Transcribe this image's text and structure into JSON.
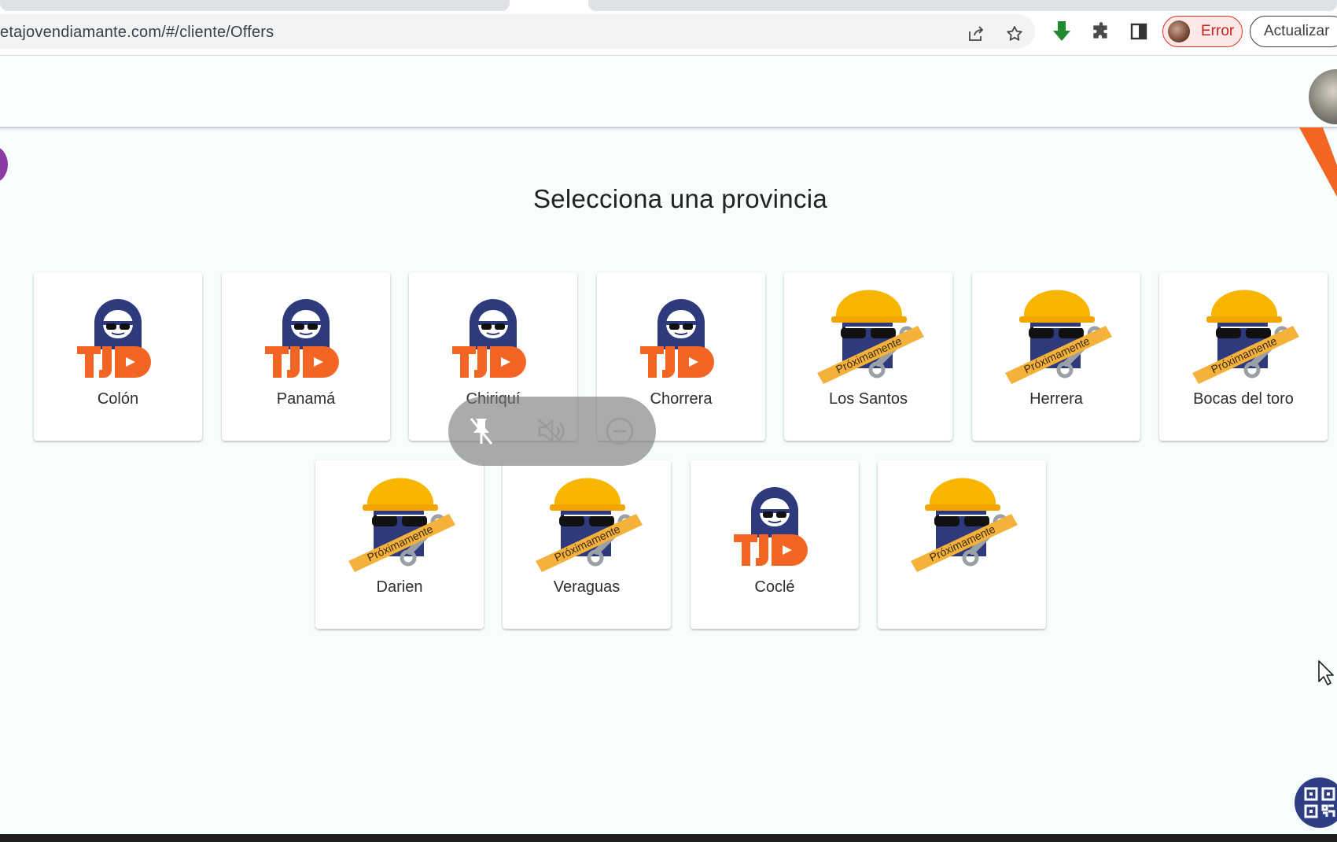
{
  "browser": {
    "url": "etajovendiamante.com/#/cliente/Offers",
    "profile_status": "Error",
    "update_label": "Actualizar"
  },
  "page": {
    "title": "Selecciona una provincia"
  },
  "provinces": [
    {
      "name": "Colón",
      "status": "available"
    },
    {
      "name": "Panamá",
      "status": "available"
    },
    {
      "name": "Chiriquí",
      "status": "available"
    },
    {
      "name": "Chorrera",
      "status": "available"
    },
    {
      "name": "Los Santos",
      "status": "coming-soon"
    },
    {
      "name": "Herrera",
      "status": "coming-soon"
    },
    {
      "name": "Bocas del toro",
      "status": "coming-soon"
    },
    {
      "name": "Darien",
      "status": "coming-soon"
    },
    {
      "name": "Veraguas",
      "status": "coming-soon"
    },
    {
      "name": "Coclé",
      "status": "available"
    },
    {
      "name": "",
      "status": "coming-soon"
    }
  ],
  "logo": {
    "text": "TJD",
    "coming_soon_text": "Próximamente"
  },
  "colors": {
    "brand_navy": "#2e3a7c",
    "brand_orange": "#f26522",
    "helmet_yellow": "#f7b500",
    "ribbon": "#f4b23a",
    "error_red": "#d93025"
  },
  "icons": {
    "share": "share-icon",
    "bookmark": "star-icon",
    "download": "download-arrow-icon",
    "extensions": "puzzle-icon",
    "side_panel": "side-panel-icon",
    "media_pin": "pin-off-icon",
    "media_mute": "muted-speaker-icon",
    "media_close": "minus-circle-icon",
    "qr": "qr-code-icon"
  }
}
